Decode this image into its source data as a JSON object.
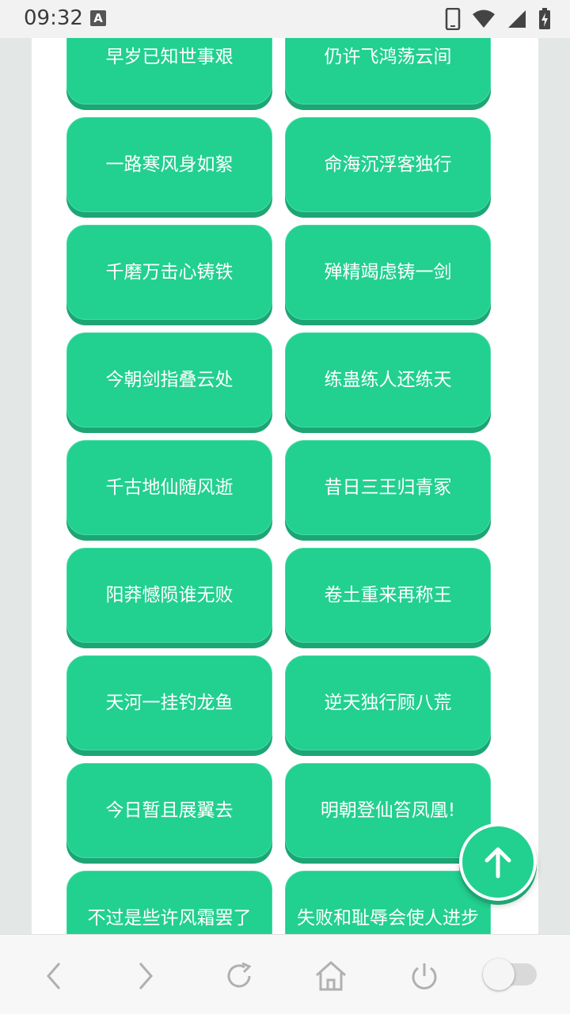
{
  "status_bar": {
    "time": "09:32",
    "notification_letter": "A"
  },
  "buttons": [
    "早岁已知世事艰",
    "仍许飞鸿荡云间",
    "一路寒风身如絮",
    "命海沉浮客独行",
    "千磨万击心铸铁",
    "殚精竭虑铸一剑",
    "今朝剑指叠云处",
    "练蛊练人还练天",
    "千古地仙随风逝",
    "昔日三王归青冢",
    "阳莽憾陨谁无败",
    "卷土重来再称王",
    "天河一挂钓龙鱼",
    "逆天独行顾八荒",
    "今日暂且展翼去",
    "明朝登仙笞凤凰!",
    "不过是些许风霜罢了",
    "失败和耻辱会使人进步"
  ],
  "fab": {
    "icon": "arrow-up-icon"
  },
  "nav": {
    "icons": [
      "back-icon",
      "forward-icon",
      "refresh-icon",
      "home-icon",
      "power-icon",
      "toggle-switch"
    ]
  },
  "colors": {
    "accent": "#22d090",
    "accent_shadow": "#1ea575",
    "page_bg": "#e3e7e6"
  }
}
